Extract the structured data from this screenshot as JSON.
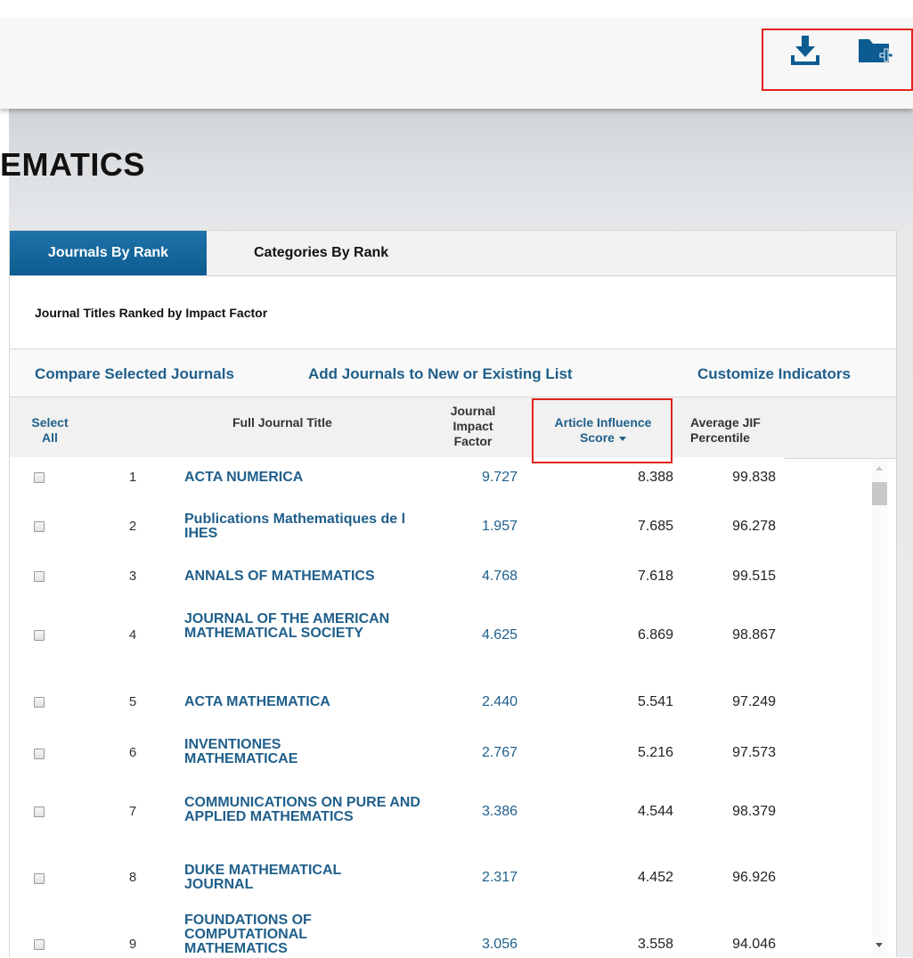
{
  "toolbar": {
    "download_icon": "download-icon",
    "add_folder_icon": "folder-plus-icon",
    "accent_color": "#0d5c91"
  },
  "page": {
    "title": "EMATICS"
  },
  "tabs": [
    {
      "label": "Journals By Rank",
      "active": true
    },
    {
      "label": "Categories By Rank",
      "active": false
    }
  ],
  "subtitle": "Journal Titles Ranked by Impact Factor",
  "actions": {
    "compare": "Compare Selected Journals",
    "add_list": "Add Journals to New or Existing List",
    "customize": "Customize Indicators"
  },
  "table": {
    "headers": {
      "select_line1": "Select",
      "select_line2": "All",
      "title": "Full Journal Title",
      "jif_line1": "Journal",
      "jif_line2": "Impact",
      "jif_line3": "Factor",
      "ais_line1": "Article Influence",
      "ais_line2": "Score",
      "avg_line1": "Average JIF",
      "avg_line2": "Percentile"
    },
    "rows": [
      {
        "rank": "1",
        "title": "ACTA NUMERICA",
        "jif": "9.727",
        "ais": "8.388",
        "avg": "99.838"
      },
      {
        "rank": "2",
        "title": "Publications Mathematiques de l IHES",
        "jif": "1.957",
        "ais": "7.685",
        "avg": "96.278"
      },
      {
        "rank": "3",
        "title": "ANNALS OF MATHEMATICS",
        "jif": "4.768",
        "ais": "7.618",
        "avg": "99.515"
      },
      {
        "rank": "4",
        "title": "JOURNAL OF THE AMERICAN MATHEMATICAL SOCIETY",
        "jif": "4.625",
        "ais": "6.869",
        "avg": "98.867"
      },
      {
        "rank": "5",
        "title": "ACTA MATHEMATICA",
        "jif": "2.440",
        "ais": "5.541",
        "avg": "97.249"
      },
      {
        "rank": "6",
        "title": "INVENTIONES MATHEMATICAE",
        "jif": "2.767",
        "ais": "5.216",
        "avg": "97.573"
      },
      {
        "rank": "7",
        "title": "COMMUNICATIONS ON PURE AND APPLIED MATHEMATICS",
        "jif": "3.386",
        "ais": "4.544",
        "avg": "98.379"
      },
      {
        "rank": "8",
        "title": "DUKE MATHEMATICAL JOURNAL",
        "jif": "2.317",
        "ais": "4.452",
        "avg": "96.926"
      },
      {
        "rank": "9",
        "title": "FOUNDATIONS OF COMPUTATIONAL MATHEMATICS",
        "jif": "3.056",
        "ais": "3.558",
        "avg": "94.046"
      }
    ]
  }
}
